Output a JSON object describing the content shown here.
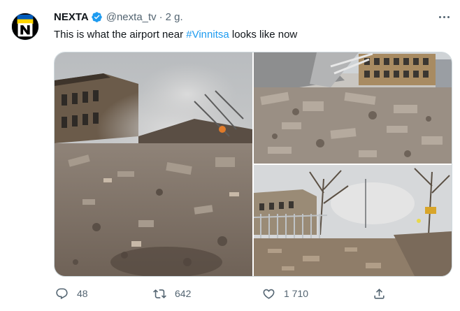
{
  "tweet": {
    "author_name": "NEXTA",
    "handle": "@nexta_tv",
    "separator": "·",
    "time": "2 g.",
    "text_before": "This is what the airport near ",
    "hashtag": "#Vinnitsa",
    "text_after": " looks like now",
    "verified_icon": "verified-badge-icon",
    "avatar_letter": "N",
    "avatar_colors": {
      "top": "#005bbb",
      "bottom": "#ffd500",
      "background": "#000000"
    }
  },
  "media": {
    "photos": [
      {
        "name": "photo-airport-ruins-smoke"
      },
      {
        "name": "photo-collapsed-terminal-rubble"
      },
      {
        "name": "photo-damaged-fence-trees"
      }
    ]
  },
  "actions": {
    "reply_count": "48",
    "retweet_count": "642",
    "like_count": "1 710",
    "icons": [
      "reply-icon",
      "retweet-icon",
      "like-icon",
      "share-icon"
    ]
  },
  "colors": {
    "accent": "#1d9bf0",
    "text": "#0f1419",
    "secondary": "#536471",
    "border": "#cfd9de"
  }
}
